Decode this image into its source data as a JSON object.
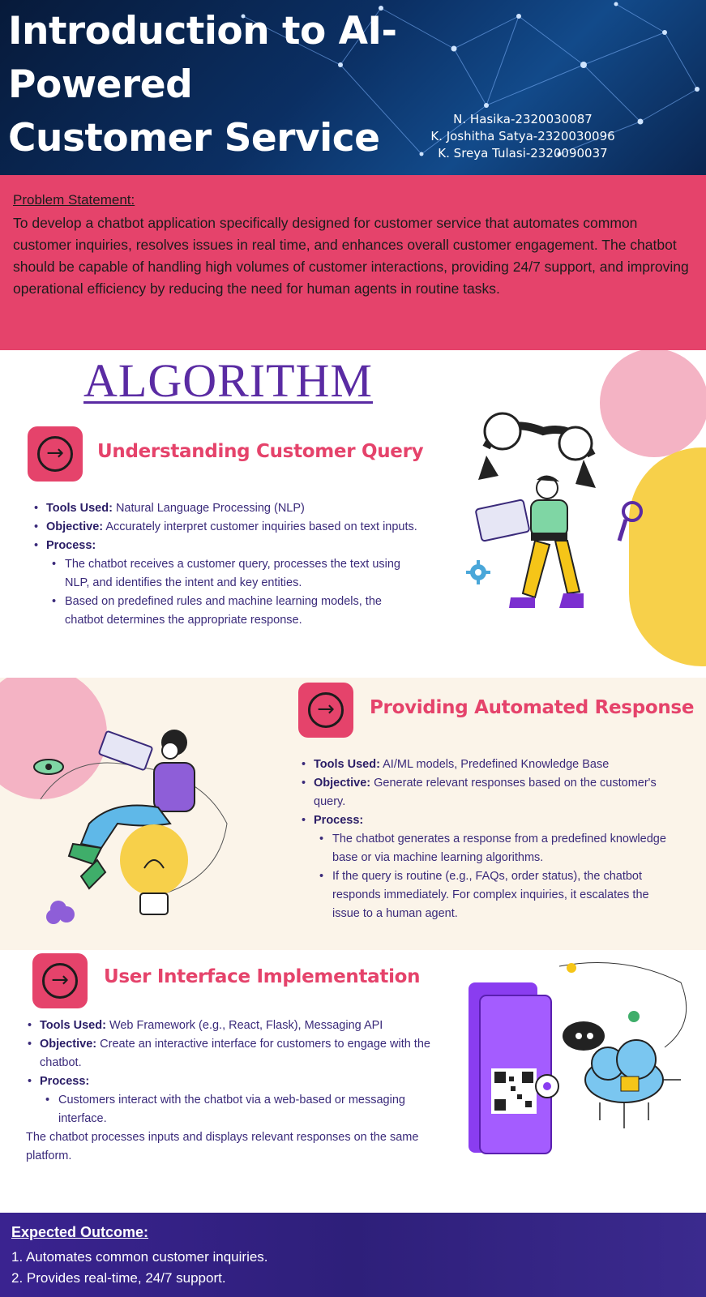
{
  "header": {
    "title": "Introduction to AI-Powered Customer Service Chatbot",
    "authors": [
      "N. Hasika-2320030087",
      "K. Joshitha Satya-2320030096",
      "K. Sreya Tulasi-2320090037"
    ]
  },
  "problem": {
    "heading": "Problem Statement:",
    "text": "To develop a chatbot application specifically designed for customer service that automates common customer inquiries, resolves issues in real time, and enhances overall customer engagement. The chatbot should be capable of handling high volumes of customer interactions, providing 24/7 support, and improving operational efficiency by reducing the need for human agents in routine tasks."
  },
  "algorithm": {
    "title": "ALGORITHM",
    "arrow_glyph": "→",
    "steps": [
      {
        "title": "Understanding Customer Query",
        "tools_label": "Tools Used:",
        "tools": "Natural Language Processing (NLP)",
        "objective_label": "Objective:",
        "objective": "Accurately interpret customer inquiries based on text inputs.",
        "process_label": "Process:",
        "process": [
          "The chatbot receives a customer query, processes the text using NLP, and identifies the intent and key entities.",
          "Based on predefined rules and machine learning models, the chatbot determines the appropriate response."
        ]
      },
      {
        "title": "Providing Automated Response",
        "tools_label": "Tools Used:",
        "tools": "AI/ML models, Predefined Knowledge Base",
        "objective_label": "Objective:",
        "objective": "Generate relevant responses based on the customer's query.",
        "process_label": "Process:",
        "process": [
          "The chatbot generates a response from a predefined knowledge base or via machine learning algorithms.",
          "If the query is routine (e.g., FAQs, order status), the chatbot responds immediately. For complex inquiries, it escalates the issue to a human agent."
        ]
      },
      {
        "title": "User Interface Implementation",
        "tools_label": "Tools Used:",
        "tools": "Web Framework (e.g., React, Flask), Messaging API",
        "objective_label": "Objective:",
        "objective": "Create an interactive interface for customers to engage with the chatbot.",
        "process_label": "Process:",
        "process": [
          "Customers interact with the chatbot via a web-based or messaging interface."
        ],
        "note": "The chatbot processes inputs and displays relevant responses on the same platform."
      }
    ]
  },
  "outcome": {
    "heading": "Expected Outcome:",
    "items": [
      "1. Automates common customer inquiries.",
      "2. Provides real-time, 24/7 support."
    ]
  },
  "colors": {
    "accent_pink": "#e5436b",
    "heading_purple": "#5a2ba3",
    "body_text": "#3a2a7a",
    "header_navy": "#0b2f63",
    "outcome_purple": "#2e1f7a"
  },
  "icons": [
    "arrow-right-circle-icon",
    "robot-arm-illustration",
    "woman-laptop-illustration",
    "magnifier-icon",
    "gear-icon",
    "lightbulb-illustration",
    "eye-icon",
    "phone-qr-illustration",
    "cloud-ai-icon",
    "robot-head-icon"
  ]
}
